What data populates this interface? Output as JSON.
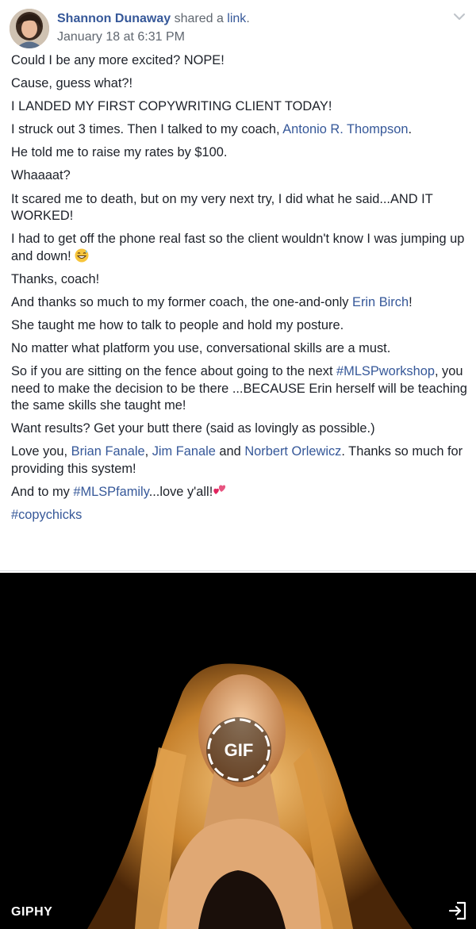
{
  "post": {
    "author": "Shannon Dunaway",
    "action": "shared a",
    "link_word": "link",
    "period": ".",
    "timestamp": "January 18 at 6:31 PM",
    "icons": {
      "menu": "chevron-down-icon",
      "open": "open-external-icon"
    }
  },
  "body": {
    "p1": "Could I be any more excited? NOPE!",
    "p2": "Cause, guess what?!",
    "p3": "I LANDED MY FIRST COPYWRITING CLIENT TODAY!",
    "p4_text": "I struck out 3 times. Then I talked to my coach, ",
    "p4_link": "Antonio R. Thompson",
    "p4_end": ".",
    "p5": "He told me to raise my rates by $100.",
    "p6": "Whaaaat?",
    "p7": "It scared me to death, but on my very next try, I did what he said...AND IT WORKED!",
    "p8": "I had to get off the phone real fast so the client wouldn't know I was jumping up and down! ",
    "p8_emoji": "grinning-sweat-emoji",
    "p9": "Thanks, coach!",
    "p10_text": "And thanks so much to my former coach, the one-and-only ",
    "p10_link": "Erin Birch",
    "p10_end": "!",
    "p11": "She taught me how to talk to people and hold my posture.",
    "p12": "No matter what platform you use, conversational skills are a must.",
    "p13_text1": "So if you are sitting on the fence about going to the next ",
    "p13_hashtag": "#MLSPworkshop",
    "p13_text2": ", you need to make the decision to be there ...BECAUSE Erin herself will be teaching the same skills she taught me!",
    "p14": "Want results? Get your butt there (said as lovingly as possible.)",
    "p15_text1": "Love you, ",
    "p15_link1": "Brian Fanale",
    "p15_sep1": ", ",
    "p15_link2": "Jim Fanale",
    "p15_sep2": " and ",
    "p15_link3": "Norbert Orlewicz",
    "p15_text2": ". Thanks so much for providing this system!",
    "p16_text1": "And to my ",
    "p16_hashtag": "#MLSPfamily",
    "p16_text2": "...love y'all!",
    "p16_emoji": "two-hearts-emoji",
    "p17_hashtag": "#copychicks"
  },
  "gif": {
    "badge_label": "GIF",
    "source_label": "GIPHY"
  },
  "colors": {
    "link": "#365899",
    "text": "#1d2129",
    "meta": "#606770",
    "gif_background": "#000000"
  }
}
